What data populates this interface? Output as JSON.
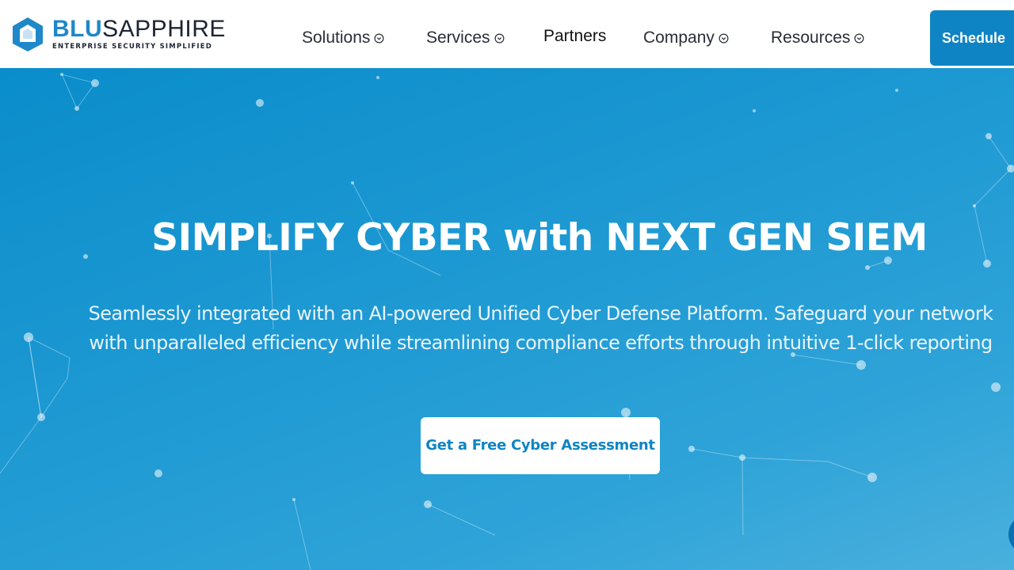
{
  "brand": {
    "name_highlight": "BLU",
    "name_rest": "SAPPHIRE",
    "tagline": "ENTERPRISE SECURITY SIMPLIFIED",
    "color": "#1e88c8"
  },
  "nav": {
    "items": [
      {
        "label": "Solutions",
        "has_dropdown": true,
        "icon": "chevron-down-circle-icon"
      },
      {
        "label": "Services",
        "has_dropdown": true,
        "icon": "chevron-down-circle-icon"
      },
      {
        "label": "Partners",
        "has_dropdown": false
      },
      {
        "label": "Company",
        "has_dropdown": true,
        "icon": "chevron-down-circle-icon"
      },
      {
        "label": "Resources",
        "has_dropdown": true,
        "icon": "chevron-down-circle-icon"
      }
    ],
    "schedule_label": "Schedule"
  },
  "hero": {
    "title": "SIMPLIFY CYBER with NEXT GEN SIEM",
    "subtitle": "Seamlessly integrated with an AI-powered Unified Cyber Defense Platform. Safeguard your network with unparalleled efficiency while streamlining compliance efforts through intuitive 1-click reporting",
    "cta_label": "Get a Free Cyber Assessment",
    "background_color": "#1c98d2",
    "background_decoration": "network-nodes"
  },
  "colors": {
    "accent": "#0f84c4",
    "text_dark": "#2a2d36",
    "white": "#ffffff"
  }
}
